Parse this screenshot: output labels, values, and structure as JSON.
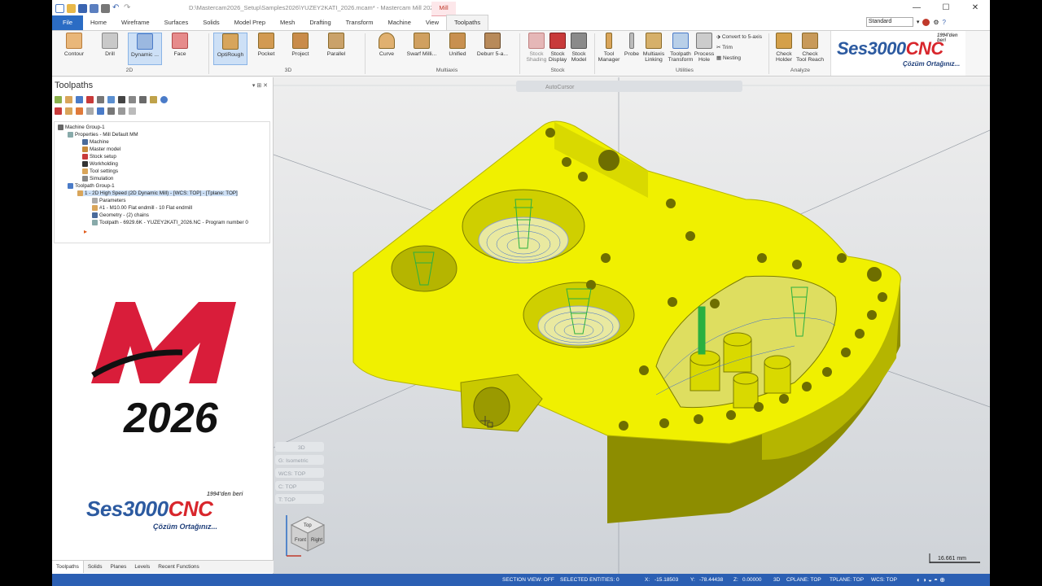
{
  "title": "D:\\Mastercam2026_Setup\\Samples2026\\YUZEY2KATI_2026.mcam* - Mastercam Mill 2026",
  "context_tab": "Mill",
  "tabs": [
    "File",
    "Home",
    "Wireframe",
    "Surfaces",
    "Solids",
    "Model Prep",
    "Mesh",
    "Drafting",
    "Transform",
    "Machine",
    "View",
    "Toolpaths"
  ],
  "active_tab": "Toolpaths",
  "view_select": "Standard",
  "ribbon": {
    "b2d": [
      "Contour",
      "Drill",
      "Dynamic ...",
      "Face"
    ],
    "b3d": [
      "OptiRough",
      "Pocket",
      "Project",
      "Parallel"
    ],
    "multi": [
      "Curve",
      "Swarf Milli...",
      "Unified",
      "Deburr 5-a..."
    ],
    "stock": [
      "Stock\nShading",
      "Stock\nDisplay",
      "Stock\nModel"
    ],
    "util": [
      "Tool\nManager",
      "Probe",
      "Multiaxis\nLinking",
      "Toolpath\nTransform",
      "Process\nHole"
    ],
    "util_small": [
      "Convert to 5-axis",
      "Trim",
      "Nesting"
    ],
    "analyze": [
      "Check\nHolder",
      "Check\nTool Reach"
    ],
    "groups": [
      "2D",
      "3D",
      "Multiaxis",
      "Stock",
      "Utilities",
      "Analyze"
    ]
  },
  "logo": {
    "tag": "1994'den beri",
    "brand": "Ses3000",
    "suffix": "CNC",
    "slogan": "Çözüm Ortağınız..."
  },
  "panel": {
    "title": "Toolpaths",
    "tree": [
      "Machine Group-1",
      "Properties - Mill Default MM",
      "Machine",
      "Master model",
      "Stock setup",
      "Workholding",
      "Tool settings",
      "Simulation",
      "Toolpath Group-1",
      "1 - 2D High Speed (2D Dynamic Mill) - [WCS: TOP] - [Tplane: TOP]",
      "Parameters",
      "#1 - M10.00 Flat endmill - 10 Flat endmill",
      "Geometry - (2) chains",
      "Toolpath - 6929.6K - YUZEY2KATI_2026.NC - Program number 0"
    ],
    "bottom_tabs": [
      "Toolpaths",
      "Solids",
      "Planes",
      "Levels",
      "Recent Functions"
    ],
    "version": "2026"
  },
  "viewport": {
    "autocursor": "AutoCursor",
    "hud": [
      "3D",
      "G: Isometric",
      "WCS: TOP",
      "C: TOP",
      "T: TOP"
    ],
    "cube": [
      "Top",
      "Front",
      "Right"
    ],
    "scale": "16.661 mm"
  },
  "status": {
    "section": "SECTION VIEW: OFF",
    "selected": "SELECTED ENTITIES: 0",
    "x_label": "X:",
    "x": "-15.18503",
    "y_label": "Y:",
    "y": "-78.44438",
    "z_label": "Z:",
    "z": "0.00000",
    "mode": "3D",
    "cplane": "CPLANE: TOP",
    "tplane": "TPLANE: TOP",
    "wcs": "WCS: TOP"
  }
}
